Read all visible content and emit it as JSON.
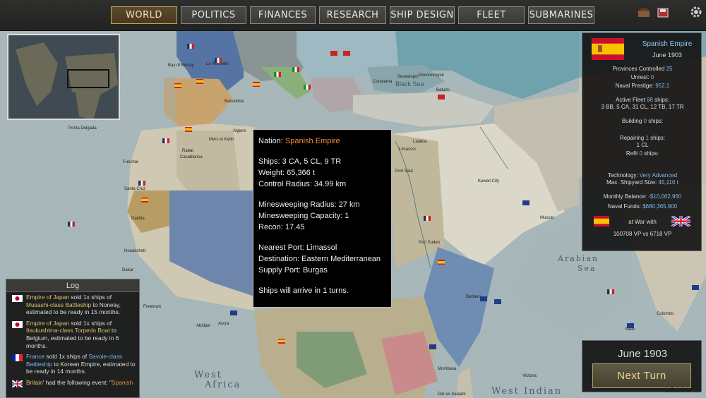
{
  "nav": {
    "world": "WORLD",
    "politics": "POLITICS",
    "finances": "FINANCES",
    "research": "RESEARCH",
    "ship_design": "SHIP DESIGN",
    "fleet": "FLEET",
    "submarines": "SUBMARINES"
  },
  "country": {
    "name": "Spanish Empire",
    "date": "June 1903",
    "provinces_label": "Provinces Controlled",
    "provinces_value": "25",
    "unrest_label": "Unrest:",
    "unrest_value": "0",
    "prestige_label": "Naval Prestige:",
    "prestige_value": "952.1",
    "fleet_label": "Active Fleet",
    "fleet_value": "68",
    "fleet_suffix": "ships:",
    "fleet_composition": "3 BB, 5 CA, 31 CL, 12 TB, 17 TR",
    "building_label": "Building",
    "building_value": "0",
    "building_suffix": "ships:",
    "repairing_label": "Repairing",
    "repairing_value": "1",
    "repairing_suffix": "ships:",
    "repairing_composition": "1 CL",
    "refit_label": "Refit",
    "refit_value": "0",
    "refit_suffix": "ships:",
    "tech_label": "Technology:",
    "tech_value": "Very Advanced",
    "shipyard_label": "Max. Shipyard Size:",
    "shipyard_value": "45,110 t",
    "balance_label": "Monthly Balance:",
    "balance_value": "-$10,062,960",
    "funds_label": "Naval Funds:",
    "funds_value": "$680,365,900",
    "war_label": "at War with",
    "war_vp": "100708 VP vs 6718 VP"
  },
  "turn": {
    "date": "June 1903",
    "next_label": "Next Turn",
    "version": "1.5.1.6 Live"
  },
  "log": {
    "title": "Log",
    "entries": [
      {
        "country": "Empire of Japan",
        "t1": " sold 1x ships of ",
        "ship": "Musashi-class Battleship",
        "t2": " to Norway, estimated to be ready in 15 months."
      },
      {
        "country": "Empire of Japan",
        "t1": " sold 1x ships of ",
        "ship": "Itsukushima-class Torpedo Boat",
        "t2": " to Belgium, estimated to be ready in 6 months."
      },
      {
        "country": "France",
        "t1": " sold 1x ships of ",
        "ship": "Savoie-class Battleship",
        "t2": " to Korean Empire, estimated to be ready in 14 months."
      },
      {
        "country": "Britain",
        "t1": "' had the following event: \"",
        "ship": "Spanish",
        "t2": ""
      }
    ]
  },
  "tooltip": {
    "nation_label": "Nation:",
    "nation_value": "Spanish Empire",
    "ships": "Ships: 3 CA, 5 CL, 9 TR",
    "weight": "Weight: 65,366 t",
    "control_radius": "Control Radius: 34.99 km",
    "minesweeping_radius": "Minesweeping Radius: 27 km",
    "minesweeping_capacity": "Minesweeping Capacity: 1",
    "recon": "Recon: 17.45",
    "nearest_port": "Nearest Port: Limassol",
    "destination": "Destination: Eastern Mediterranean",
    "supply_port": "Supply Port: Burgas",
    "arrival": "Ships will arrive in 1 turns."
  },
  "map_labels": {
    "bay_biscay": "Bay of Biscay",
    "la_rochelle": "La Rochelle",
    "barcelona": "Barcelona",
    "ponta_delgada": "Ponta Delgada",
    "funchal": "Funchal",
    "rabat": "Rabat",
    "casablanca": "Casablanca",
    "mers_el_kebir": "Mers el Kebir",
    "algiers": "Algiers",
    "santa_cruz": "Santa Cruz",
    "dakhla": "Dakhla",
    "nouakchott": "Nouakchott",
    "dakar": "Dakar",
    "freetown": "Freetown",
    "abidjan": "Abidjan",
    "accra": "Accra",
    "black_sea": "Black Sea",
    "sevastopol": "Sevastopol",
    "novorossiysk": "Novorossiysk",
    "constanta": "Constanta",
    "batumi": "Batumi",
    "limassol": "Limassol",
    "latakia": "Latakia",
    "port_said": "Port Said",
    "kuwait": "Kuwait City",
    "port_sudan": "Port Sudan",
    "muscat": "Muscat",
    "berbera": "Berbera",
    "mombasa": "Mombasa",
    "dar": "Dar es Salaam",
    "victoria": "Victoria",
    "male": "Male",
    "colombo": "Colombo",
    "arabian_sea": "Arabian",
    "arabian_sea2": "Sea",
    "west_africa": "West",
    "west_africa2": "Africa",
    "west_indian": "West Indian"
  },
  "colors": {
    "accent_gold": "#c6a45a",
    "highlight_blue": "#7bb6ec",
    "tooltip_orange": "#f08b38"
  }
}
